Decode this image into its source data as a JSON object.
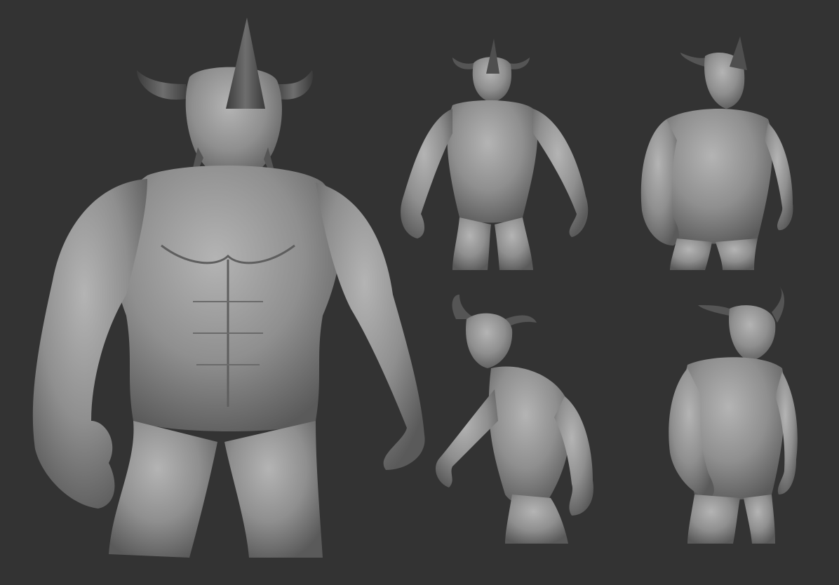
{
  "scene": {
    "background_color": "#333333",
    "clay_color": "#8f8f8f",
    "clay_light": "#b4b4b4",
    "clay_dark": "#4a4a4a",
    "horn_color": "#5a5a5a",
    "views": [
      {
        "name": "front-large",
        "pose": "front"
      },
      {
        "name": "front-small",
        "pose": "front"
      },
      {
        "name": "three-quarter",
        "pose": "three-quarter-right"
      },
      {
        "name": "side-left",
        "pose": "three-quarter-left"
      },
      {
        "name": "side-right",
        "pose": "three-quarter-right"
      }
    ]
  }
}
